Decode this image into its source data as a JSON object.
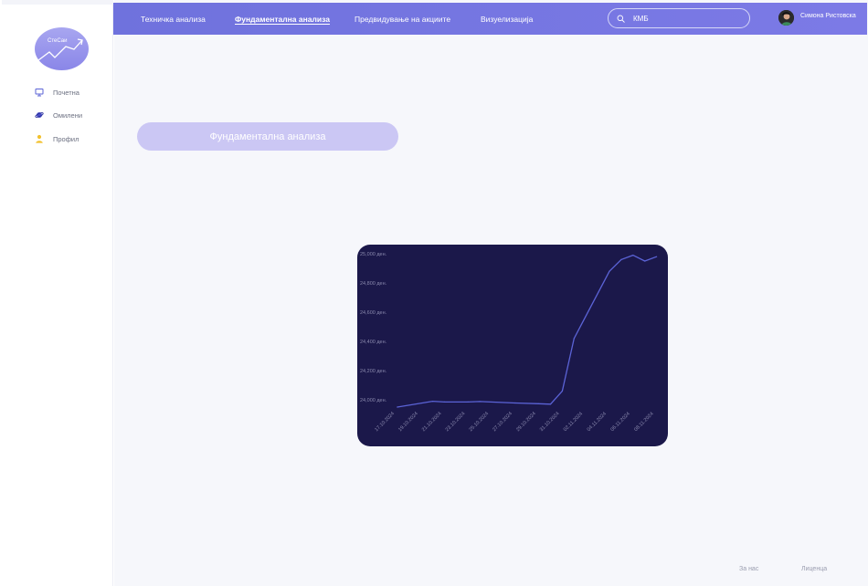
{
  "sidebar": {
    "logo_text": "СтеСаи",
    "items": [
      {
        "label": "Почетна"
      },
      {
        "label": "Омилени"
      },
      {
        "label": "Профил"
      }
    ]
  },
  "topbar": {
    "tabs": [
      {
        "label": "Техничка анализа",
        "active": false
      },
      {
        "label": "Фундаментална анализа",
        "active": true
      },
      {
        "label": "Предвидување на акциите",
        "active": false
      },
      {
        "label": "Визуелизација",
        "active": false
      }
    ],
    "search": {
      "value": "КМБ",
      "placeholder": ""
    },
    "user_name": "Симона Ристовска"
  },
  "main": {
    "pill_label": "Фундаментална анализа"
  },
  "footer": {
    "about": "За нас",
    "license": "Лиценца"
  },
  "colors": {
    "accent": "#7375e0",
    "chart_bg": "#1b184a",
    "chart_line": "#5b63d6"
  },
  "chart_data": {
    "type": "line",
    "x": [
      "17.10.2024",
      "19.10.2024",
      "21.10.2024",
      "23.10.2024",
      "25.10.2024",
      "27.10.2024",
      "29.10.2024",
      "31.10.2024",
      "02.11.2024",
      "04.11.2024",
      "06.11.2024",
      "08.11.2024"
    ],
    "series": [
      {
        "values": [
          {
            "x": "18.10.2024",
            "y": 23950
          },
          {
            "x": "21.10.2024",
            "y": 23990
          },
          {
            "x": "22.10.2024",
            "y": 23985
          },
          {
            "x": "24.10.2024",
            "y": 23985
          },
          {
            "x": "25.10.2024",
            "y": 23988
          },
          {
            "x": "28.10.2024",
            "y": 23978
          },
          {
            "x": "30.10.2024",
            "y": 23973
          },
          {
            "x": "31.10.2024",
            "y": 23970
          },
          {
            "x": "01.11.2024",
            "y": 24060
          },
          {
            "x": "02.11.2024",
            "y": 24420
          },
          {
            "x": "05.11.2024",
            "y": 24880
          },
          {
            "x": "06.11.2024",
            "y": 24960
          },
          {
            "x": "07.11.2024",
            "y": 24990
          },
          {
            "x": "08.11.2024",
            "y": 24950
          },
          {
            "x": "09.11.2024",
            "y": 24980
          }
        ]
      }
    ],
    "y_ticks": [
      "25,000 ден.",
      "24,800 ден.",
      "24,600 ден.",
      "24,400 ден.",
      "24,200 ден.",
      "24,000 ден."
    ],
    "ylim": [
      24000,
      25000
    ],
    "grid": false,
    "legend": "none",
    "title": "",
    "xlabel": "",
    "ylabel": ""
  }
}
